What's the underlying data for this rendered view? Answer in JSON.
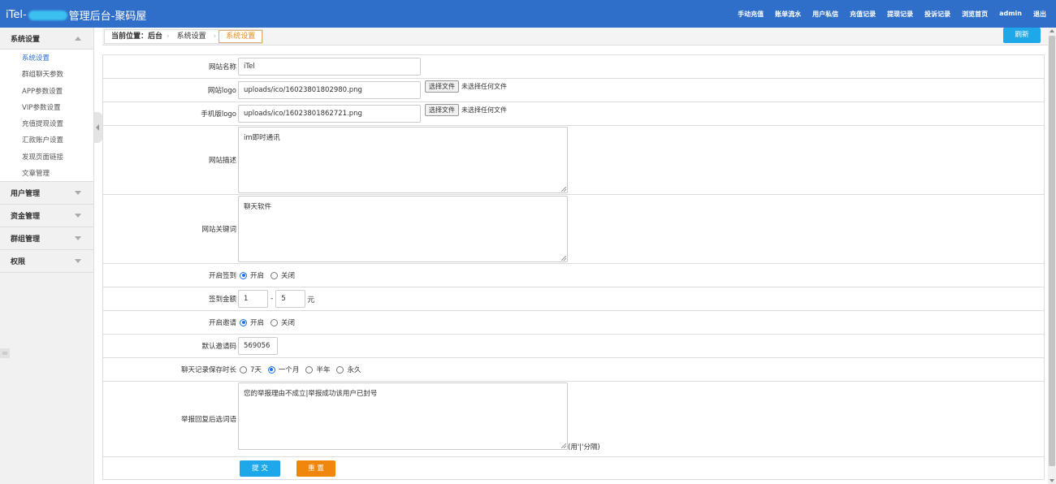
{
  "header": {
    "brand_prefix": "iTel-",
    "brand_suffix": "管理后台-聚码屋",
    "nav": [
      "手动充值",
      "账单流水",
      "用户私信",
      "充值记录",
      "提现记录",
      "投诉记录",
      "浏览首页",
      "admin",
      "退出"
    ]
  },
  "sidebar": {
    "groups": [
      {
        "label": "系统设置",
        "expanded": true,
        "items": [
          "系统设置",
          "群组聊天参数",
          "APP参数设置",
          "VIP参数设置",
          "充值提现设置",
          "汇款账户设置",
          "发现页面链接",
          "文章管理"
        ]
      },
      {
        "label": "用户管理",
        "expanded": false
      },
      {
        "label": "资金管理",
        "expanded": false
      },
      {
        "label": "群组管理",
        "expanded": false
      },
      {
        "label": "权限",
        "expanded": false
      }
    ]
  },
  "breadcrumb": {
    "label": "当前位置：",
    "home": "后台",
    "section": "系统设置",
    "current": "系统设置",
    "refresh": "刷新"
  },
  "form": {
    "site_name": {
      "label": "网站名称",
      "value": "iTel"
    },
    "site_logo": {
      "label": "网站logo",
      "value": "uploads/ico/16023801802980.png",
      "button": "选择文件",
      "status": "未选择任何文件"
    },
    "mobile_logo": {
      "label": "手机版logo",
      "value": "uploads/ico/16023801862721.png",
      "button": "选择文件",
      "status": "未选择任何文件"
    },
    "site_desc": {
      "label": "网站描述",
      "value": "im即时通讯"
    },
    "site_keywords": {
      "label": "网站关键词",
      "value": "聊天软件"
    },
    "checkin": {
      "label": "开启签到",
      "options": [
        "开启",
        "关闭"
      ],
      "selected": 0
    },
    "checkin_amount": {
      "label": "签到金额",
      "min": "1",
      "sep": "-",
      "max": "5",
      "unit": "元"
    },
    "invite": {
      "label": "开启邀请",
      "options": [
        "开启",
        "关闭"
      ],
      "selected": 0
    },
    "default_invite": {
      "label": "默认邀请码",
      "value": "569056"
    },
    "chat_retention": {
      "label": "聊天记录保存时长",
      "options": [
        "7天",
        "一个月",
        "半年",
        "永久"
      ],
      "selected": 1
    },
    "report_reply": {
      "label": "举报回复后选词语",
      "value": "您的举报理由不成立|举报成功该用户已封号",
      "hint": "(用'|'分隔)"
    },
    "submit": "提 交",
    "reset": "重 置"
  }
}
